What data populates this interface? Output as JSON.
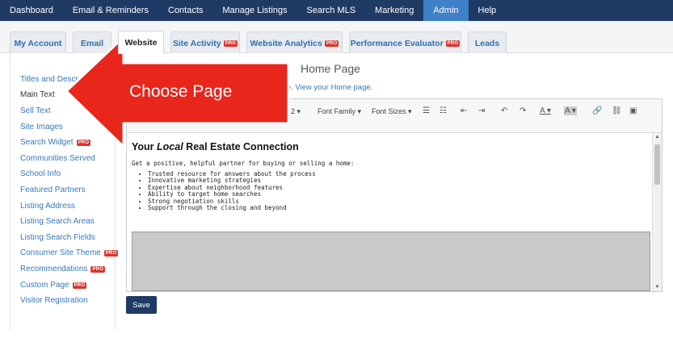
{
  "topnav": {
    "items": [
      {
        "label": "Dashboard"
      },
      {
        "label": "Email & Reminders"
      },
      {
        "label": "Contacts"
      },
      {
        "label": "Manage Listings"
      },
      {
        "label": "Search MLS"
      },
      {
        "label": "Marketing"
      },
      {
        "label": "Admin",
        "active": true
      },
      {
        "label": "Help"
      }
    ]
  },
  "tabs": {
    "items": [
      {
        "label": "My Account"
      },
      {
        "label": "Email"
      },
      {
        "label": "Website",
        "active": true
      },
      {
        "label": "Site Activity",
        "pro": "PRO"
      },
      {
        "label": "Website Analytics",
        "pro": "PRO"
      },
      {
        "label": "Performance Evaluator",
        "pro": "PRO"
      },
      {
        "label": "Leads"
      }
    ]
  },
  "sidebar": {
    "items": [
      {
        "label": "Titles and Descr"
      },
      {
        "label": "Main Text",
        "active": true
      },
      {
        "label": "Sell Text"
      },
      {
        "label": "Site Images"
      },
      {
        "label": "Search Widget",
        "pro": "PRO"
      },
      {
        "label": "Communities Served"
      },
      {
        "label": "School Info"
      },
      {
        "label": "Featured Partners"
      },
      {
        "label": "Listing Address"
      },
      {
        "label": "Listing Search Areas"
      },
      {
        "label": "Listing Search Fields"
      },
      {
        "label": "Consumer Site Theme",
        "pro": "PRO"
      },
      {
        "label": "Recommendations",
        "pro": "PRO"
      },
      {
        "label": "Custom Page",
        "pro": "PRO"
      },
      {
        "label": "Visitor Registration"
      }
    ]
  },
  "main": {
    "heading": "Home Page",
    "desc_prefix": "bsite.",
    "desc_link": "View your Home page."
  },
  "editor": {
    "toolbar": {
      "heading_select": "2 ▾",
      "font_family": "Font Family ▾",
      "font_sizes": "Font Sizes ▾"
    },
    "content": {
      "title_pre": "Your ",
      "title_em": "Local",
      "title_post": " Real Estate Connection",
      "intro": "Get a positive, helpful partner for buying or selling a home:",
      "bullets": [
        "Trusted resource for answers about the process",
        "Innovative marketing strategies",
        "Expertise about neighborhood features",
        "Ability to target home searches",
        "Strong negotiation skills",
        "Support through the closing and beyond"
      ]
    }
  },
  "save_label": "Save",
  "callout": {
    "text": "Choose Page",
    "color": "#e8261c"
  },
  "colors": {
    "nav_bg": "#1f3a64",
    "nav_active": "#3f80c8",
    "link": "#3279bd",
    "pro_badge": "#d9352b"
  }
}
